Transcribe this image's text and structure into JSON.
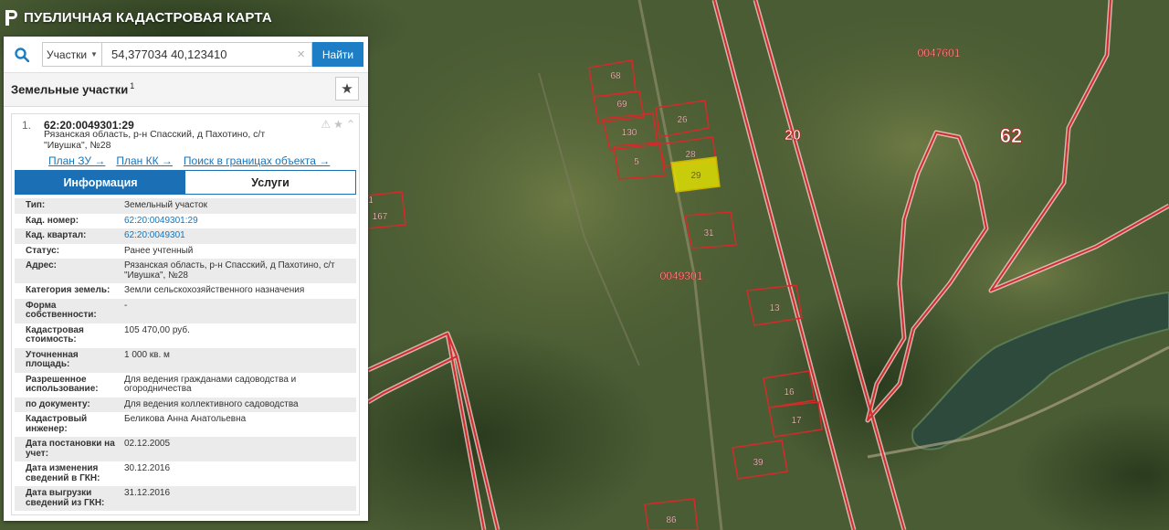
{
  "app": {
    "title": "ПУБЛИЧНАЯ КАДАСТРОВАЯ КАРТА"
  },
  "search": {
    "type_label": "Участки",
    "value": "54,377034 40,123410",
    "button_label": "Найти",
    "clear_glyph": "×"
  },
  "results": {
    "title": "Земельные участки",
    "count": "1",
    "bookmark_glyph": "★"
  },
  "result": {
    "index": "1.",
    "cad_number": "62:20:0049301:29",
    "address_lines": [
      "Рязанская область, р-н Спасский, д Пахотино, с/т",
      "\"Ивушка\", №28"
    ],
    "links": [
      "План ЗУ →",
      "План КК →",
      "Поиск в границах объекта →"
    ],
    "tabs": [
      "Информация",
      "Услуги"
    ]
  },
  "info_rows": [
    {
      "label": "Тип:",
      "value": "Земельный участок"
    },
    {
      "label": "Кад. номер:",
      "value": "62:20:0049301:29",
      "link": true
    },
    {
      "label": "Кад. квартал:",
      "value": "62:20:0049301",
      "link": true
    },
    {
      "label": "Статус:",
      "value": "Ранее учтенный"
    },
    {
      "label": "Адрес:",
      "value": "Рязанская область, р-н Спасский, д Пахотино, с/т \"Ивушка\", №28"
    },
    {
      "label": "Категория земель:",
      "value": "Земли сельскохозяйственного назначения"
    },
    {
      "label": "Форма собственности:",
      "value": "-"
    },
    {
      "label": "Кадастровая стоимость:",
      "value": "105 470,00 руб."
    },
    {
      "label": "Уточненная площадь:",
      "value": "1 000 кв. м"
    },
    {
      "label": "Разрешенное использование:",
      "value": "Для ведения гражданами садоводства и огородничества"
    },
    {
      "label": "по документу:",
      "value": "Для ведения коллективного садоводства"
    },
    {
      "label": "Кадастровый инженер:",
      "value": "Беликова Анна Анатольевна"
    },
    {
      "label": "Дата постановки на учет:",
      "value": "02.12.2005"
    },
    {
      "label": "Дата изменения сведений в ГКН:",
      "value": "30.12.2016"
    },
    {
      "label": "Дата выгрузки сведений из ГКН:",
      "value": "31.12.2016"
    }
  ],
  "map": {
    "colors": {
      "boundary": "#d42a2a",
      "boundary_halo": "#f3d0d0",
      "selected": "#e6e600",
      "label": "#ffffff"
    },
    "parcel_labels": [
      "68",
      "69",
      "26",
      "130",
      "28",
      "5",
      "29",
      "31",
      "13",
      "16",
      "17",
      "39",
      "86",
      "167",
      "1"
    ],
    "quarter_labels": [
      "0049301",
      "0047601"
    ],
    "district_label": "62",
    "road_label": "20"
  }
}
